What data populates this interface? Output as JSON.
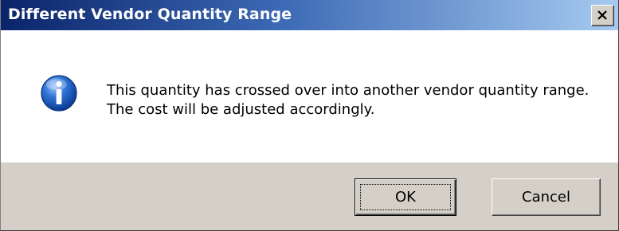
{
  "window": {
    "title": "Different Vendor Quantity Range"
  },
  "message": {
    "icon": "information-icon",
    "text": "This quantity has crossed over into another vendor quantity range.  The cost will be adjusted accordingly."
  },
  "buttons": {
    "ok_label": "OK",
    "cancel_label": "Cancel"
  },
  "colors": {
    "titlebar_start": "#0a246a",
    "titlebar_end": "#a6caf0",
    "dialog_face": "#d4d0c8",
    "icon_blue": "#1e5fc0"
  }
}
